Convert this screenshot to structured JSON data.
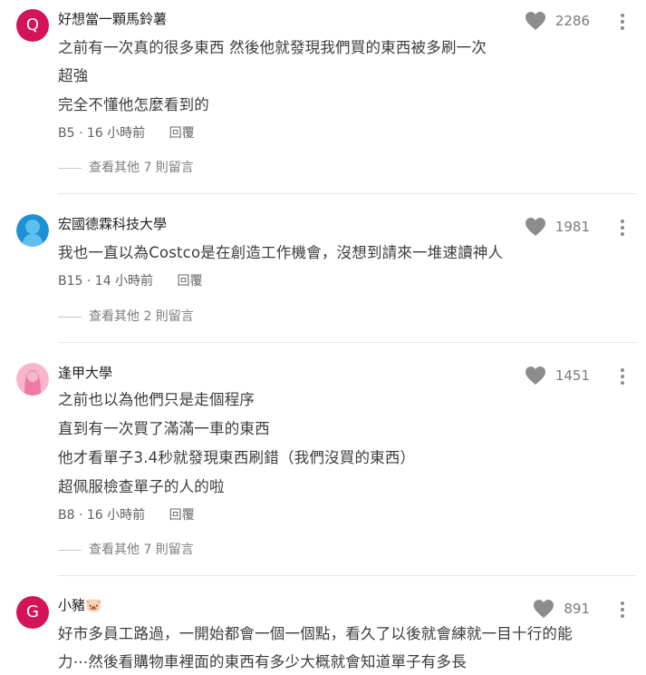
{
  "comments": [
    {
      "author": "好想當一顆馬鈴薯",
      "avatar_letter": "Q",
      "avatar_color": "#d4145a",
      "likes": "2286",
      "lines": [
        "之前有一次真的很多東西 然後他就發現我們買的東西被多刷一次",
        "超強",
        "完全不懂他怎麼看到的"
      ],
      "floor": "B5",
      "time": "16 小時前",
      "reply_label": "回覆",
      "more_replies": "查看其他 7 則留言"
    },
    {
      "author": "宏國德霖科技大學",
      "avatar_icon": "person-blue-icon",
      "avatar_color": "#1e90d6",
      "likes": "1981",
      "lines": [
        "我也一直以為Costco是在創造工作機會，沒想到請來一堆速讀神人"
      ],
      "floor": "B15",
      "time": "14 小時前",
      "reply_label": "回覆",
      "more_replies": "查看其他 2 則留言"
    },
    {
      "author": "逢甲大學",
      "avatar_icon": "person-pink-icon",
      "avatar_color": "#ef7aa6",
      "likes": "1451",
      "lines": [
        "之前也以為他們只是走個程序",
        "直到有一次買了滿滿一車的東西",
        "他才看單子3.4秒就發現東西刷錯（我們沒買的東西）",
        "超佩服檢查單子的人的啦"
      ],
      "floor": "B8",
      "time": "16 小時前",
      "reply_label": "回覆",
      "more_replies": "查看其他 7 則留言"
    },
    {
      "author": "小豬🐷",
      "avatar_letter": "G",
      "avatar_color": "#d4145a",
      "likes": "891",
      "lines": [
        "好市多員工路過，一開始都會一個一個點，看久了以後就會練就一目十行的能",
        "力⋯然後看購物車裡面的東西有多少大概就會知道單子有多長"
      ]
    }
  ],
  "separator": "·",
  "icons": {
    "like": "heart-icon",
    "menu": "more-vertical-icon"
  },
  "colors": {
    "heart": "#8c8c8c",
    "text": "#3c3c3c",
    "muted": "#7d7d7d"
  }
}
